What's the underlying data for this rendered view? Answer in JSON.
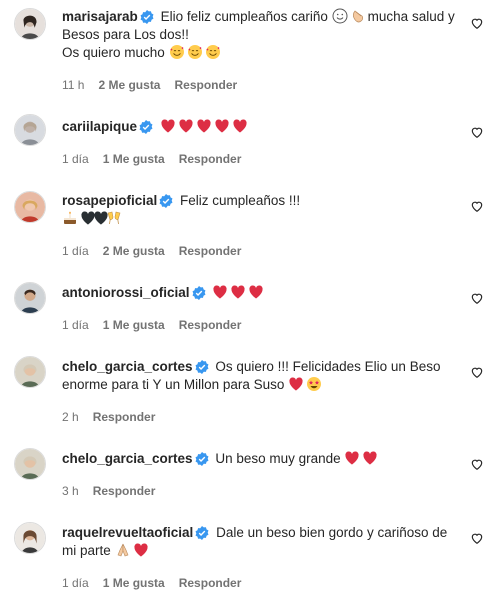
{
  "comments": [
    {
      "username": "marisajarab",
      "text1": "Elio feliz cumpleaños cariño ",
      "emoji1": "slight-smile-emoji",
      "emoji2": "clapping-hands-emoji",
      "text2": "mucha salud y",
      "line2": "Besos para Los dos!!",
      "line3": "Os quiero mucho",
      "emojis3": [
        "smiling-face-with-hearts-emoji",
        "smiling-face-with-hearts-emoji",
        "smiling-face-with-hearts-emoji"
      ],
      "time": "11 h",
      "likes": "2 Me gusta",
      "reply": "Responder"
    },
    {
      "username": "cariilapique",
      "emojis": [
        "red-heart-emoji",
        "red-heart-emoji",
        "red-heart-emoji",
        "red-heart-emoji",
        "red-heart-emoji"
      ],
      "time": "1 día",
      "likes": "1 Me gusta",
      "reply": "Responder"
    },
    {
      "username": "rosapepioficial",
      "text1": "Feliz cumpleaños !!!",
      "line2_emojis": [
        "birthday-cake-emoji",
        "black-heart-emoji",
        "black-heart-emoji",
        "clinking-glasses-emoji"
      ],
      "time": "1 día",
      "likes": "2 Me gusta",
      "reply": "Responder"
    },
    {
      "username": "antoniorossi_oficial",
      "emojis": [
        "red-heart-emoji",
        "red-heart-emoji",
        "red-heart-emoji"
      ],
      "time": "1 día",
      "likes": "1 Me gusta",
      "reply": "Responder"
    },
    {
      "username": "chelo_garcia_cortes",
      "text1": "Os quiero !!! Felicidades Elio un Beso",
      "line2": "enorme para ti Y un Millon para Suso",
      "emojis2": [
        "red-heart-emoji",
        "star-struck-emoji"
      ],
      "time": "2 h",
      "reply": "Responder"
    },
    {
      "username": "chelo_garcia_cortes",
      "text1": "Un beso muy grande",
      "emojis": [
        "red-heart-emoji",
        "red-heart-emoji"
      ],
      "time": "3 h",
      "reply": "Responder"
    },
    {
      "username": "raquelrevueltaoficial",
      "text1": "Dale un beso bien gordo y cariñoso de",
      "line2": "mi parte",
      "emojis2": [
        "folded-hands-emoji",
        "red-heart-emoji"
      ],
      "time": "1 día",
      "likes": "1 Me gusta",
      "reply": "Responder"
    }
  ],
  "colors": {
    "verified": "#3897f0",
    "heart": "#e0245e",
    "meta": "#737373",
    "text": "#262626"
  }
}
